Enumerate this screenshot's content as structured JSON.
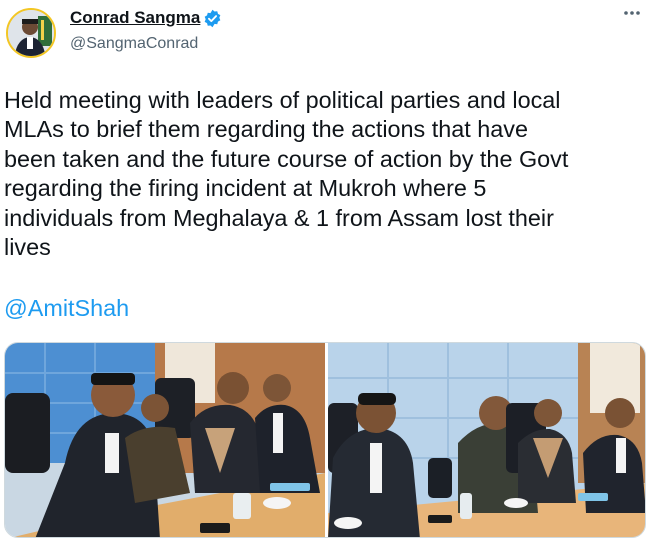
{
  "author": {
    "name": "Conrad Sangma",
    "handle": "@SangmaConrad",
    "verified": true
  },
  "tweet": {
    "text": "Held meeting with leaders of political parties and local\nMLAs to brief them regarding the actions that have\nbeen taken and the future course of action by the Govt\nregarding the firing incident at Mukroh where 5\nindividuals from Meghalaya & 1 from Assam lost their\nlives",
    "mention": "@AmitShah"
  },
  "colors": {
    "link": "#1d9bf0",
    "verified": "#1d9bf0",
    "secondary_text": "#536471"
  },
  "icons": {
    "verified": "verified-badge-icon",
    "more": "more-options-icon"
  },
  "media": [
    {
      "description_icon": "meeting-photo-1"
    },
    {
      "description_icon": "meeting-photo-2"
    }
  ]
}
